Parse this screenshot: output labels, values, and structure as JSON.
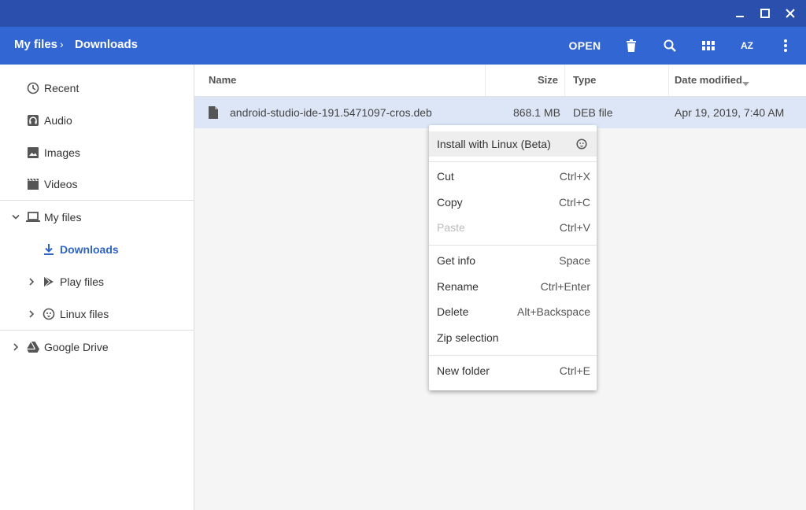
{
  "breadcrumb": {
    "root": "My files",
    "separator": "›",
    "current": "Downloads"
  },
  "toolbar": {
    "open_label": "OPEN",
    "icons": [
      "trash-icon",
      "search-icon",
      "grid-view-icon",
      "sort-az-icon",
      "more-vert-icon"
    ],
    "sort_label": "AZ"
  },
  "sidebar": {
    "items": [
      {
        "label": "Recent",
        "icon": "clock-icon"
      },
      {
        "label": "Audio",
        "icon": "headphones-icon"
      },
      {
        "label": "Images",
        "icon": "image-icon"
      },
      {
        "label": "Videos",
        "icon": "video-icon"
      },
      {
        "label": "My files",
        "icon": "laptop-icon"
      },
      {
        "label": "Downloads",
        "icon": "download-icon"
      },
      {
        "label": "Play files",
        "icon": "play-store-icon"
      },
      {
        "label": "Linux files",
        "icon": "penguin-icon"
      },
      {
        "label": "Google Drive",
        "icon": "drive-icon"
      }
    ]
  },
  "columns": {
    "name": "Name",
    "size": "Size",
    "type": "Type",
    "date": "Date modified"
  },
  "file": {
    "name": "android-studio-ide-191.5471097-cros.deb",
    "size": "868.1 MB",
    "type": "DEB file",
    "date": "Apr 19, 2019, 7:40 AM"
  },
  "menu": {
    "install": "Install with Linux (Beta)",
    "cut": "Cut",
    "cut_key": "Ctrl+X",
    "copy": "Copy",
    "copy_key": "Ctrl+C",
    "paste": "Paste",
    "paste_key": "Ctrl+V",
    "info": "Get info",
    "info_key": "Space",
    "rename": "Rename",
    "rename_key": "Ctrl+Enter",
    "delete": "Delete",
    "delete_key": "Alt+Backspace",
    "zip": "Zip selection",
    "new_folder": "New folder",
    "new_folder_key": "Ctrl+E"
  },
  "colors": {
    "titlebar": "#2b4fac",
    "toolbar": "#3166d3",
    "selection": "#dde6f7",
    "accent": "#2f64c6"
  }
}
